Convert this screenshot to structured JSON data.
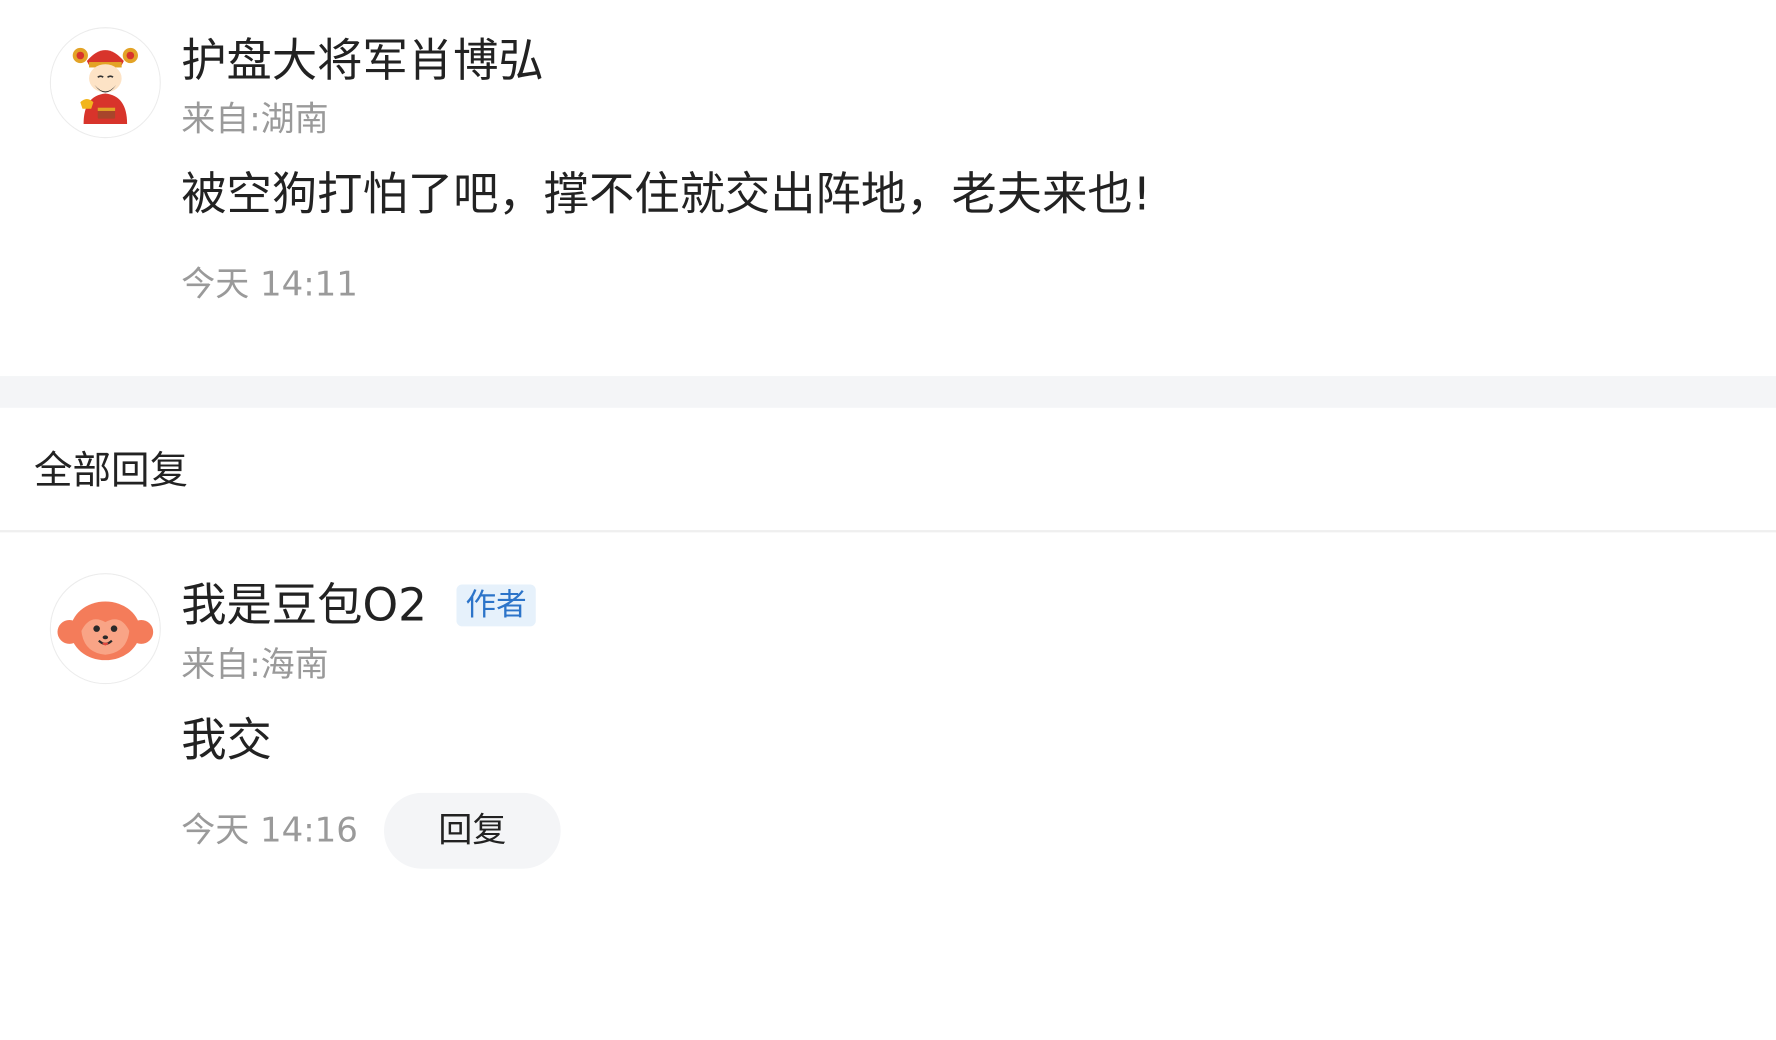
{
  "original_comment": {
    "username": "护盘大将军肖博弘",
    "location": "来自:湖南",
    "content": "被空狗打怕了吧，撑不住就交出阵地，老夫来也!",
    "time": "今天 14:11",
    "avatar_icon": "god-of-wealth-avatar-icon"
  },
  "replies_section": {
    "title": "全部回复"
  },
  "reply": {
    "username": "我是豆包O2",
    "badge": "作者",
    "location": "来自:海南",
    "content": "我交",
    "time": "今天 14:16",
    "reply_button_label": "回复",
    "avatar_icon": "orange-monkey-avatar-icon"
  },
  "colors": {
    "text_primary": "#222222",
    "text_secondary": "#9a9a9a",
    "badge_bg": "#e6f1fb",
    "badge_text": "#2c74c9",
    "section_gap_bg": "#f4f5f7",
    "reply_button_bg": "#f4f5f7",
    "monkey_avatar": "#f47c5a"
  }
}
